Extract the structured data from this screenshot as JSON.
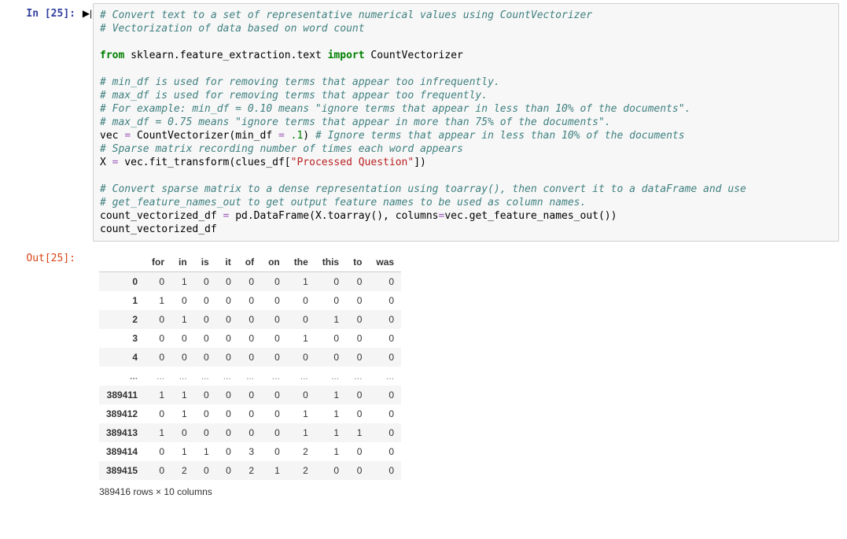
{
  "input": {
    "prompt": "In [25]:",
    "run_glyph": "▶|",
    "code_lines": [
      {
        "segs": [
          {
            "t": "# Convert text to a set of representative numerical values using CountVectorizer",
            "cls": "c"
          }
        ]
      },
      {
        "segs": [
          {
            "t": "# Vectorization of data based on word count",
            "cls": "c"
          }
        ]
      },
      {
        "segs": []
      },
      {
        "segs": [
          {
            "t": "from",
            "cls": "kw"
          },
          {
            "t": " ",
            "cls": "nm"
          },
          {
            "t": "sklearn.feature_extraction.text",
            "cls": "nm"
          },
          {
            "t": " ",
            "cls": "nm"
          },
          {
            "t": "import",
            "cls": "kw"
          },
          {
            "t": " CountVectorizer",
            "cls": "nm"
          }
        ]
      },
      {
        "segs": []
      },
      {
        "segs": [
          {
            "t": "# min_df is used for removing terms that appear too infrequently.",
            "cls": "c"
          }
        ]
      },
      {
        "segs": [
          {
            "t": "# max_df is used for removing terms that appear too frequently.",
            "cls": "c"
          }
        ]
      },
      {
        "segs": [
          {
            "t": "# For example: min_df = 0.10 means \"ignore terms that appear in less than 10% of the documents\".",
            "cls": "c"
          }
        ]
      },
      {
        "segs": [
          {
            "t": "# max_df = 0.75 means \"ignore terms that appear in more than 75% of the documents\".",
            "cls": "c"
          }
        ]
      },
      {
        "segs": [
          {
            "t": "vec ",
            "cls": "nm"
          },
          {
            "t": "=",
            "cls": "op"
          },
          {
            "t": " CountVectorizer(min_df ",
            "cls": "nm"
          },
          {
            "t": "=",
            "cls": "op"
          },
          {
            "t": " ",
            "cls": "nm"
          },
          {
            "t": ".1",
            "cls": "num"
          },
          {
            "t": ") ",
            "cls": "nm"
          },
          {
            "t": "# Ignore terms that appear in less than 10% of the documents",
            "cls": "c"
          }
        ]
      },
      {
        "segs": [
          {
            "t": "# Sparse matrix recording number of times each word appears",
            "cls": "c"
          }
        ]
      },
      {
        "segs": [
          {
            "t": "X ",
            "cls": "nm"
          },
          {
            "t": "=",
            "cls": "op"
          },
          {
            "t": " vec.fit_transform(clues_df[",
            "cls": "nm"
          },
          {
            "t": "\"Processed Question\"",
            "cls": "str"
          },
          {
            "t": "])",
            "cls": "nm"
          }
        ]
      },
      {
        "segs": []
      },
      {
        "segs": [
          {
            "t": "# Convert sparse matrix to a dense representation using toarray(), then convert it to a dataFrame and use",
            "cls": "c"
          }
        ]
      },
      {
        "segs": [
          {
            "t": "# get_feature_names_out to get output feature names to be used as column names.",
            "cls": "c"
          }
        ]
      },
      {
        "segs": [
          {
            "t": "count_vectorized_df ",
            "cls": "nm"
          },
          {
            "t": "=",
            "cls": "op"
          },
          {
            "t": " pd.DataFrame(X.toarray(), columns",
            "cls": "nm"
          },
          {
            "t": "=",
            "cls": "op"
          },
          {
            "t": "vec.get_feature_names_out())",
            "cls": "nm"
          }
        ]
      },
      {
        "segs": [
          {
            "t": "count_vectorized_df",
            "cls": "nm"
          }
        ]
      }
    ]
  },
  "output": {
    "prompt": "Out[25]:",
    "caption": "389416 rows × 10 columns"
  },
  "chart_data": {
    "type": "table",
    "columns": [
      "for",
      "in",
      "is",
      "it",
      "of",
      "on",
      "the",
      "this",
      "to",
      "was"
    ],
    "index": [
      "0",
      "1",
      "2",
      "3",
      "4",
      "...",
      "389411",
      "389412",
      "389413",
      "389414",
      "389415"
    ],
    "rows": [
      [
        0,
        1,
        0,
        0,
        0,
        0,
        1,
        0,
        0,
        0
      ],
      [
        1,
        0,
        0,
        0,
        0,
        0,
        0,
        0,
        0,
        0
      ],
      [
        0,
        1,
        0,
        0,
        0,
        0,
        0,
        1,
        0,
        0
      ],
      [
        0,
        0,
        0,
        0,
        0,
        0,
        1,
        0,
        0,
        0
      ],
      [
        0,
        0,
        0,
        0,
        0,
        0,
        0,
        0,
        0,
        0
      ],
      [
        "...",
        "...",
        "...",
        "...",
        "...",
        "...",
        "...",
        "...",
        "...",
        "..."
      ],
      [
        1,
        1,
        0,
        0,
        0,
        0,
        0,
        1,
        0,
        0
      ],
      [
        0,
        1,
        0,
        0,
        0,
        0,
        1,
        1,
        0,
        0
      ],
      [
        1,
        0,
        0,
        0,
        0,
        0,
        1,
        1,
        1,
        0
      ],
      [
        0,
        1,
        1,
        0,
        3,
        0,
        2,
        1,
        0,
        0
      ],
      [
        0,
        2,
        0,
        0,
        2,
        1,
        2,
        0,
        0,
        0
      ]
    ]
  }
}
